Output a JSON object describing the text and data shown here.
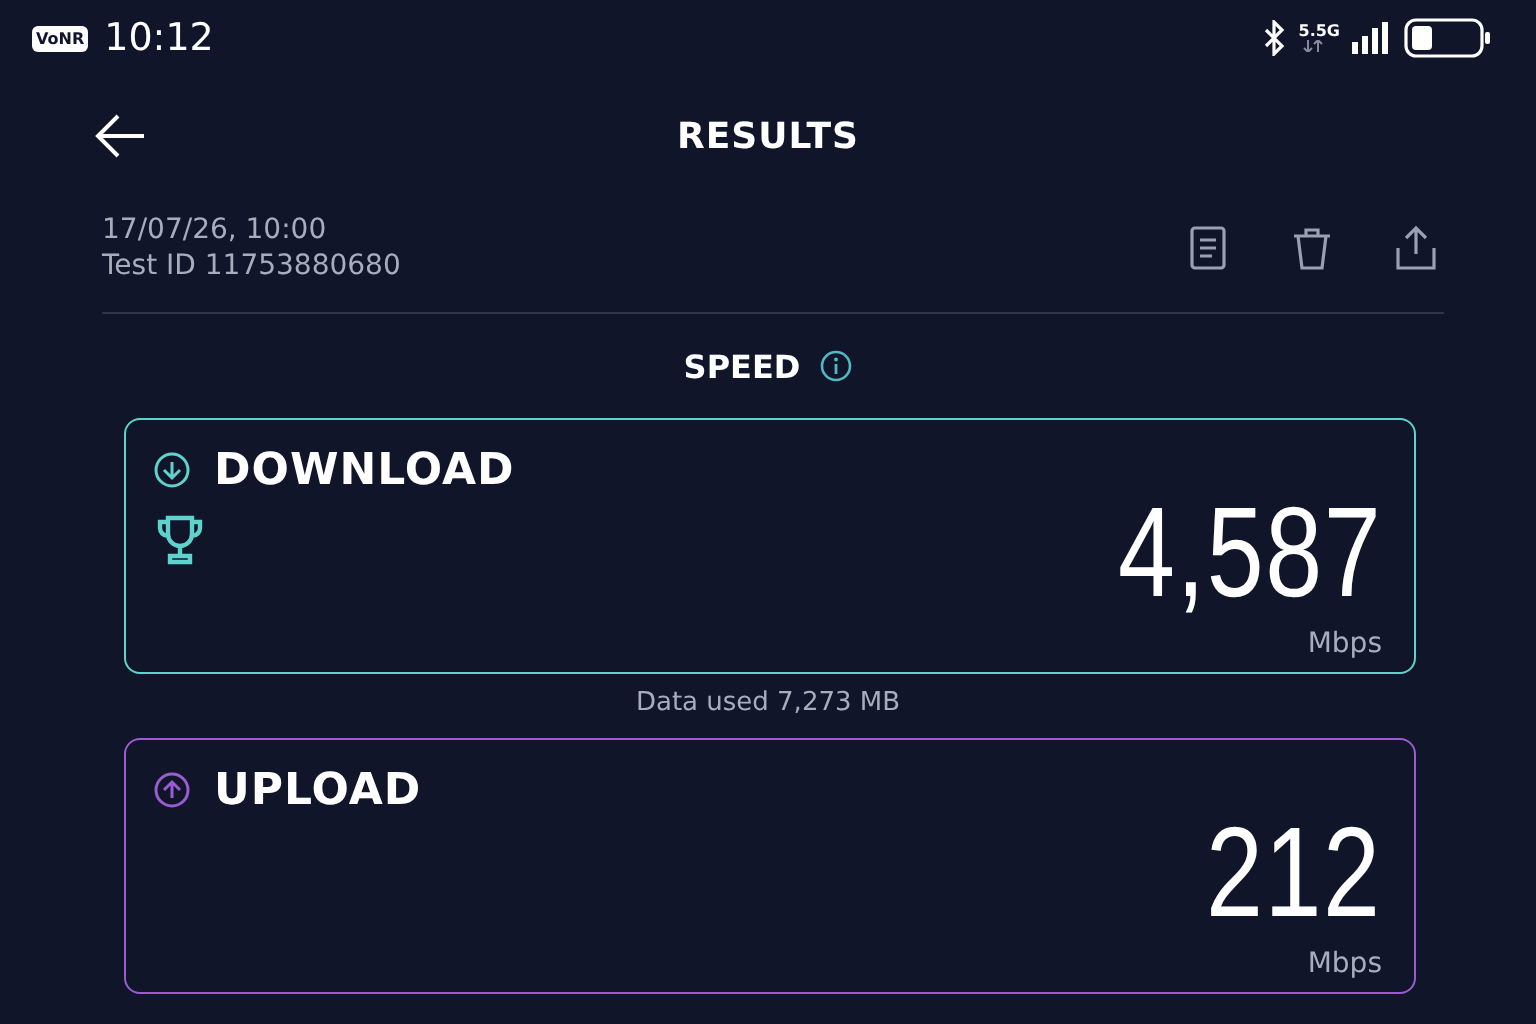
{
  "status_bar": {
    "badge": "VoNR",
    "time": "10:12",
    "network": "5.5G"
  },
  "header": {
    "title": "RESULTS"
  },
  "meta": {
    "date": "17/07/26, 10:00",
    "test_id": "Test ID 11753880680"
  },
  "section": {
    "title": "SPEED"
  },
  "cards": [
    {
      "kind": "download",
      "label": "DOWNLOAD",
      "color": "#5fd3cb",
      "trophy": true,
      "value": "4,587",
      "unit": "Mbps",
      "note": "Data used 7,273 MB"
    },
    {
      "kind": "upload",
      "label": "UPLOAD",
      "color": "#9a5cd0",
      "trophy": false,
      "value": "212",
      "unit": "Mbps"
    }
  ]
}
